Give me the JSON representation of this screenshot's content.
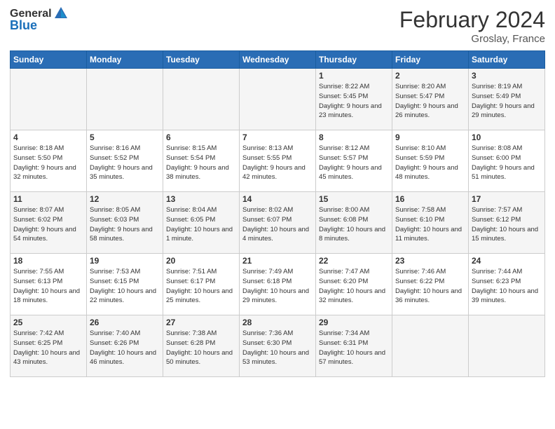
{
  "header": {
    "logo_general": "General",
    "logo_blue": "Blue",
    "month_title": "February 2024",
    "location": "Groslay, France"
  },
  "days_of_week": [
    "Sunday",
    "Monday",
    "Tuesday",
    "Wednesday",
    "Thursday",
    "Friday",
    "Saturday"
  ],
  "weeks": [
    [
      {
        "day": "",
        "sunrise": "",
        "sunset": "",
        "daylight": ""
      },
      {
        "day": "",
        "sunrise": "",
        "sunset": "",
        "daylight": ""
      },
      {
        "day": "",
        "sunrise": "",
        "sunset": "",
        "daylight": ""
      },
      {
        "day": "",
        "sunrise": "",
        "sunset": "",
        "daylight": ""
      },
      {
        "day": "1",
        "sunrise": "Sunrise: 8:22 AM",
        "sunset": "Sunset: 5:45 PM",
        "daylight": "Daylight: 9 hours and 23 minutes."
      },
      {
        "day": "2",
        "sunrise": "Sunrise: 8:20 AM",
        "sunset": "Sunset: 5:47 PM",
        "daylight": "Daylight: 9 hours and 26 minutes."
      },
      {
        "day": "3",
        "sunrise": "Sunrise: 8:19 AM",
        "sunset": "Sunset: 5:49 PM",
        "daylight": "Daylight: 9 hours and 29 minutes."
      }
    ],
    [
      {
        "day": "4",
        "sunrise": "Sunrise: 8:18 AM",
        "sunset": "Sunset: 5:50 PM",
        "daylight": "Daylight: 9 hours and 32 minutes."
      },
      {
        "day": "5",
        "sunrise": "Sunrise: 8:16 AM",
        "sunset": "Sunset: 5:52 PM",
        "daylight": "Daylight: 9 hours and 35 minutes."
      },
      {
        "day": "6",
        "sunrise": "Sunrise: 8:15 AM",
        "sunset": "Sunset: 5:54 PM",
        "daylight": "Daylight: 9 hours and 38 minutes."
      },
      {
        "day": "7",
        "sunrise": "Sunrise: 8:13 AM",
        "sunset": "Sunset: 5:55 PM",
        "daylight": "Daylight: 9 hours and 42 minutes."
      },
      {
        "day": "8",
        "sunrise": "Sunrise: 8:12 AM",
        "sunset": "Sunset: 5:57 PM",
        "daylight": "Daylight: 9 hours and 45 minutes."
      },
      {
        "day": "9",
        "sunrise": "Sunrise: 8:10 AM",
        "sunset": "Sunset: 5:59 PM",
        "daylight": "Daylight: 9 hours and 48 minutes."
      },
      {
        "day": "10",
        "sunrise": "Sunrise: 8:08 AM",
        "sunset": "Sunset: 6:00 PM",
        "daylight": "Daylight: 9 hours and 51 minutes."
      }
    ],
    [
      {
        "day": "11",
        "sunrise": "Sunrise: 8:07 AM",
        "sunset": "Sunset: 6:02 PM",
        "daylight": "Daylight: 9 hours and 54 minutes."
      },
      {
        "day": "12",
        "sunrise": "Sunrise: 8:05 AM",
        "sunset": "Sunset: 6:03 PM",
        "daylight": "Daylight: 9 hours and 58 minutes."
      },
      {
        "day": "13",
        "sunrise": "Sunrise: 8:04 AM",
        "sunset": "Sunset: 6:05 PM",
        "daylight": "Daylight: 10 hours and 1 minute."
      },
      {
        "day": "14",
        "sunrise": "Sunrise: 8:02 AM",
        "sunset": "Sunset: 6:07 PM",
        "daylight": "Daylight: 10 hours and 4 minutes."
      },
      {
        "day": "15",
        "sunrise": "Sunrise: 8:00 AM",
        "sunset": "Sunset: 6:08 PM",
        "daylight": "Daylight: 10 hours and 8 minutes."
      },
      {
        "day": "16",
        "sunrise": "Sunrise: 7:58 AM",
        "sunset": "Sunset: 6:10 PM",
        "daylight": "Daylight: 10 hours and 11 minutes."
      },
      {
        "day": "17",
        "sunrise": "Sunrise: 7:57 AM",
        "sunset": "Sunset: 6:12 PM",
        "daylight": "Daylight: 10 hours and 15 minutes."
      }
    ],
    [
      {
        "day": "18",
        "sunrise": "Sunrise: 7:55 AM",
        "sunset": "Sunset: 6:13 PM",
        "daylight": "Daylight: 10 hours and 18 minutes."
      },
      {
        "day": "19",
        "sunrise": "Sunrise: 7:53 AM",
        "sunset": "Sunset: 6:15 PM",
        "daylight": "Daylight: 10 hours and 22 minutes."
      },
      {
        "day": "20",
        "sunrise": "Sunrise: 7:51 AM",
        "sunset": "Sunset: 6:17 PM",
        "daylight": "Daylight: 10 hours and 25 minutes."
      },
      {
        "day": "21",
        "sunrise": "Sunrise: 7:49 AM",
        "sunset": "Sunset: 6:18 PM",
        "daylight": "Daylight: 10 hours and 29 minutes."
      },
      {
        "day": "22",
        "sunrise": "Sunrise: 7:47 AM",
        "sunset": "Sunset: 6:20 PM",
        "daylight": "Daylight: 10 hours and 32 minutes."
      },
      {
        "day": "23",
        "sunrise": "Sunrise: 7:46 AM",
        "sunset": "Sunset: 6:22 PM",
        "daylight": "Daylight: 10 hours and 36 minutes."
      },
      {
        "day": "24",
        "sunrise": "Sunrise: 7:44 AM",
        "sunset": "Sunset: 6:23 PM",
        "daylight": "Daylight: 10 hours and 39 minutes."
      }
    ],
    [
      {
        "day": "25",
        "sunrise": "Sunrise: 7:42 AM",
        "sunset": "Sunset: 6:25 PM",
        "daylight": "Daylight: 10 hours and 43 minutes."
      },
      {
        "day": "26",
        "sunrise": "Sunrise: 7:40 AM",
        "sunset": "Sunset: 6:26 PM",
        "daylight": "Daylight: 10 hours and 46 minutes."
      },
      {
        "day": "27",
        "sunrise": "Sunrise: 7:38 AM",
        "sunset": "Sunset: 6:28 PM",
        "daylight": "Daylight: 10 hours and 50 minutes."
      },
      {
        "day": "28",
        "sunrise": "Sunrise: 7:36 AM",
        "sunset": "Sunset: 6:30 PM",
        "daylight": "Daylight: 10 hours and 53 minutes."
      },
      {
        "day": "29",
        "sunrise": "Sunrise: 7:34 AM",
        "sunset": "Sunset: 6:31 PM",
        "daylight": "Daylight: 10 hours and 57 minutes."
      },
      {
        "day": "",
        "sunrise": "",
        "sunset": "",
        "daylight": ""
      },
      {
        "day": "",
        "sunrise": "",
        "sunset": "",
        "daylight": ""
      }
    ]
  ]
}
